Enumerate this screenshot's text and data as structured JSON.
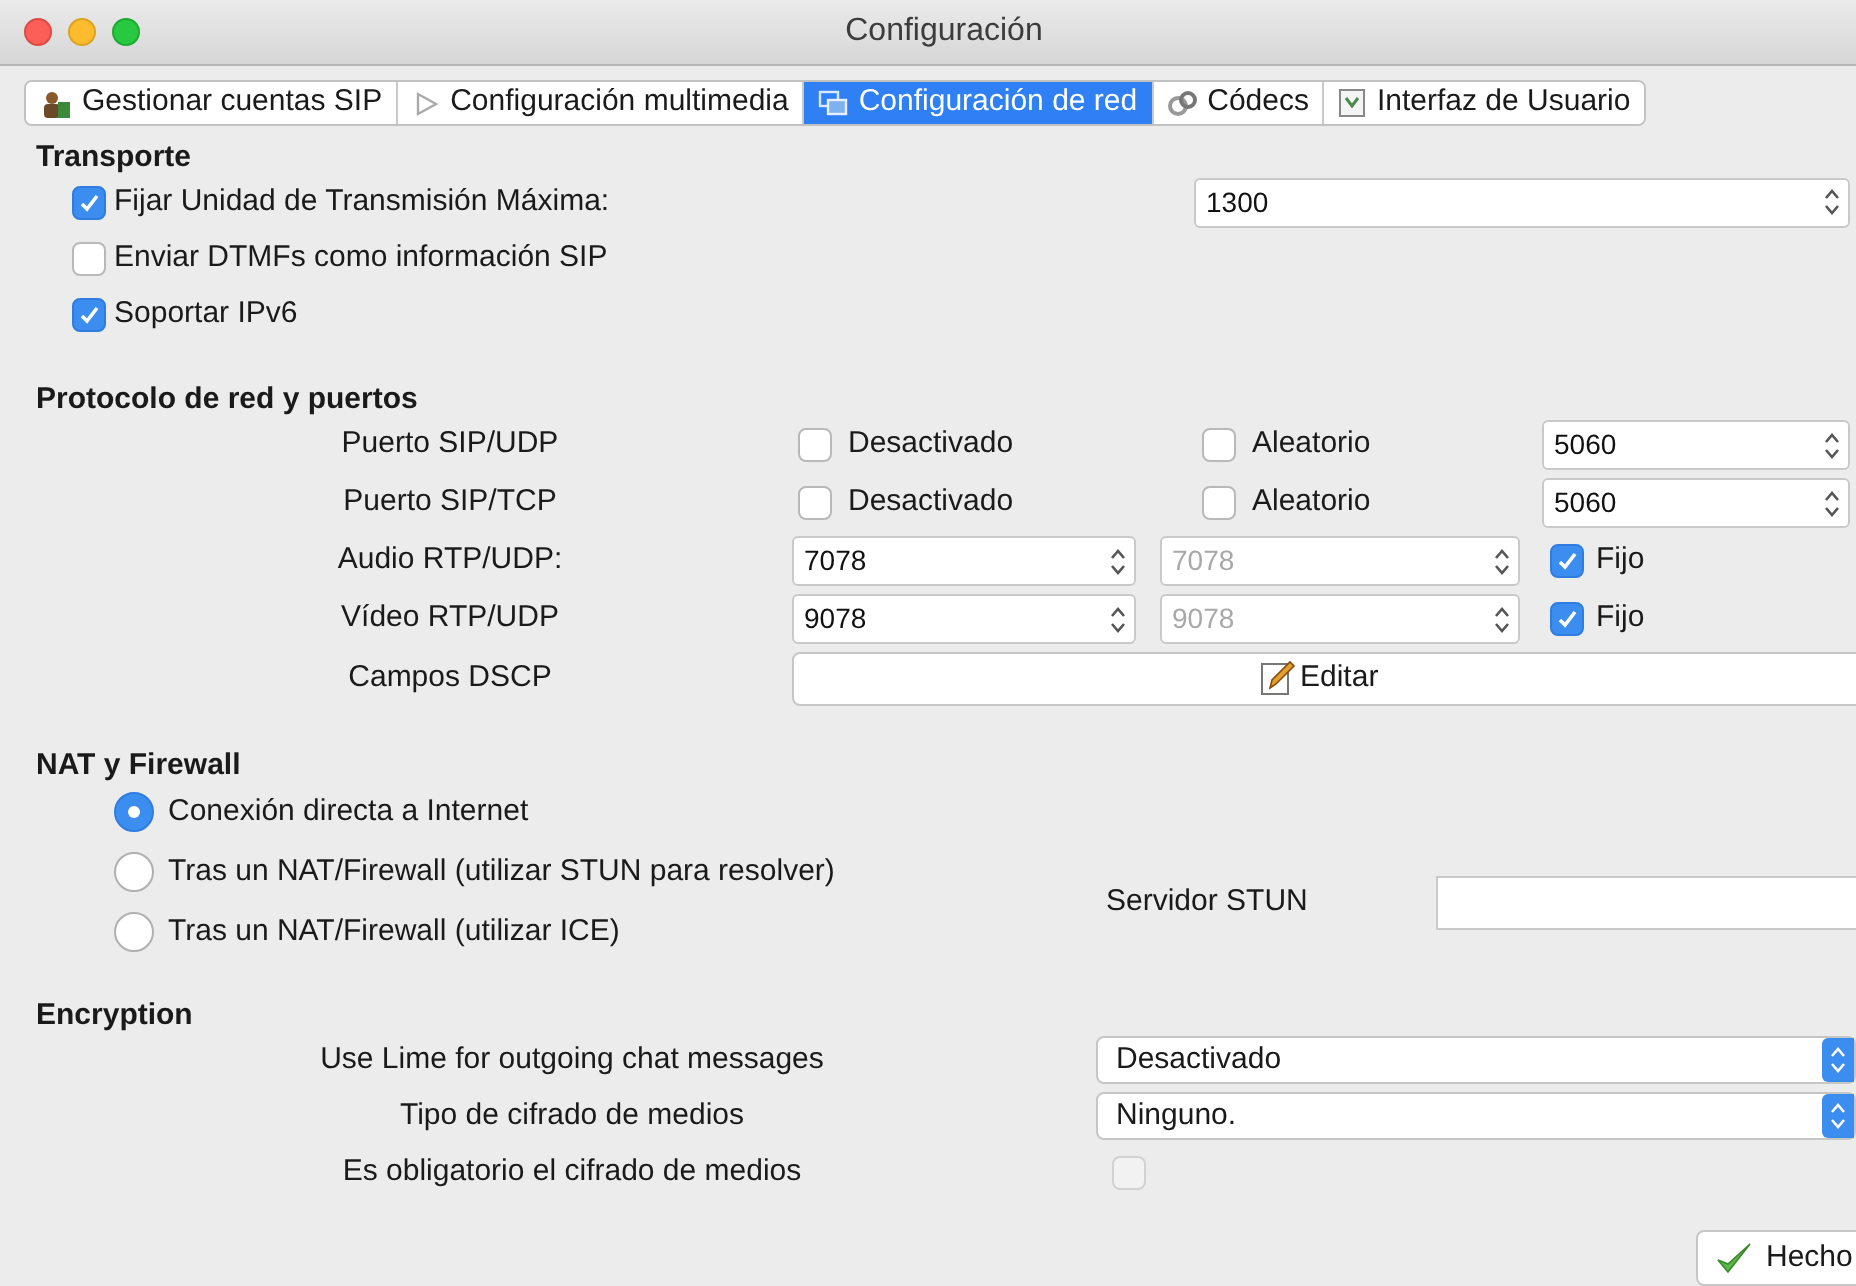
{
  "window": {
    "title": "Configuración"
  },
  "tabs": [
    {
      "label": "Gestionar cuentas SIP",
      "selected": false
    },
    {
      "label": "Configuración multimedia",
      "selected": false
    },
    {
      "label": "Configuración de red",
      "selected": true
    },
    {
      "label": "Códecs",
      "selected": false
    },
    {
      "label": "Interfaz de Usuario",
      "selected": false
    }
  ],
  "transport": {
    "heading": "Transporte",
    "options": [
      {
        "label": "Fijar Unidad de Transmisión Máxima:",
        "checked": true,
        "value": "1300"
      },
      {
        "label": "Enviar DTMFs como información SIP",
        "checked": false
      },
      {
        "label": "Soportar IPv6",
        "checked": true
      }
    ]
  },
  "network": {
    "heading": "Protocolo de red y puertos",
    "ports": [
      {
        "kind": "toggles",
        "label": "Puerto SIP/UDP",
        "disabled_option": {
          "label": "Desactivado",
          "checked": false
        },
        "random_option": {
          "label": "Aleatorio",
          "checked": false
        },
        "value": "5060"
      },
      {
        "kind": "toggles",
        "label": "Puerto SIP/TCP",
        "disabled_option": {
          "label": "Desactivado",
          "checked": false
        },
        "random_option": {
          "label": "Aleatorio",
          "checked": false
        },
        "value": "5060"
      },
      {
        "kind": "range",
        "label": "Audio RTP/UDP:",
        "value": "7078",
        "end_value": "7078",
        "end_disabled": true,
        "fixed": {
          "label": "Fijo",
          "checked": true
        }
      },
      {
        "kind": "range",
        "label": "Vídeo RTP/UDP",
        "value": "9078",
        "end_value": "9078",
        "end_disabled": true,
        "fixed": {
          "label": "Fijo",
          "checked": true
        }
      }
    ],
    "dscp": {
      "label": "Campos DSCP",
      "button": "Editar"
    }
  },
  "nat": {
    "heading": "NAT y Firewall",
    "options": [
      {
        "label": "Conexión directa a Internet",
        "selected": true
      },
      {
        "label": "Tras un NAT/Firewall (utilizar STUN para resolver)",
        "selected": false
      },
      {
        "label": "Tras un NAT/Firewall (utilizar ICE)",
        "selected": false
      }
    ],
    "stun_label": "Servidor STUN"
  },
  "encryption": {
    "heading": "Encryption",
    "rows": [
      {
        "kind": "select",
        "label": "Use Lime for outgoing chat messages",
        "value": "Desactivado"
      },
      {
        "kind": "select",
        "label": "Tipo de cifrado de medios",
        "value": "Ninguno."
      },
      {
        "kind": "checkbox",
        "label": "Es obligatorio el cifrado de medios",
        "checked": false
      }
    ]
  },
  "done_button": "Hecho"
}
